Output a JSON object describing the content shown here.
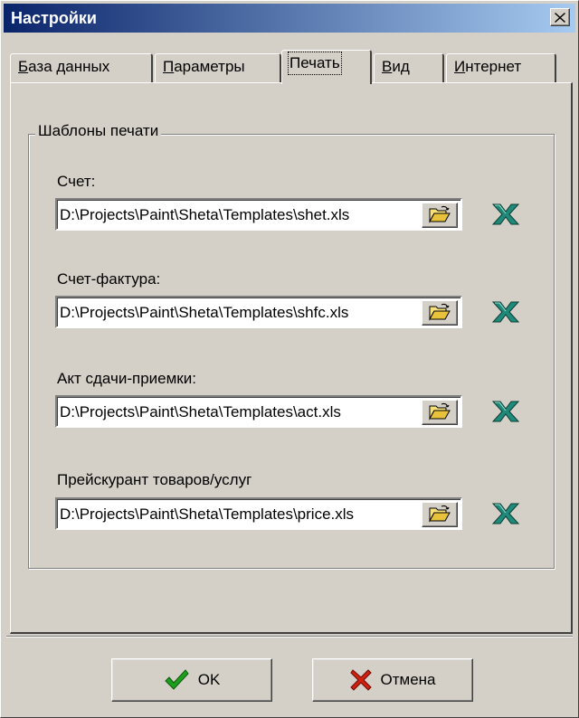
{
  "window": {
    "title": "Настройки"
  },
  "tabs": [
    {
      "key": "db",
      "label": "База данных",
      "accel": "Б",
      "rest": "аза данных"
    },
    {
      "key": "params",
      "label": "Параметры",
      "accel": "П",
      "rest": "араметры"
    },
    {
      "key": "print",
      "label": "Печать",
      "accel": "",
      "rest": "Печать",
      "active": true
    },
    {
      "key": "view",
      "label": "Вид",
      "accel": "В",
      "rest": "ид"
    },
    {
      "key": "internet",
      "label": "Интернет",
      "accel": "И",
      "rest": "нтернет"
    }
  ],
  "print_templates": {
    "group_title": "Шаблоны печати",
    "fields": [
      {
        "label": "Счет:",
        "value": "D:\\Projects\\Paint\\Sheta\\Templates\\shet.xls"
      },
      {
        "label": "Счет-фактура:",
        "value": "D:\\Projects\\Paint\\Sheta\\Templates\\shfc.xls"
      },
      {
        "label": "Акт сдачи-приемки:",
        "value": "D:\\Projects\\Paint\\Sheta\\Templates\\act.xls"
      },
      {
        "label": "Прейскурант товаров/услуг",
        "value": "D:\\Projects\\Paint\\Sheta\\Templates\\price.xls"
      }
    ]
  },
  "icons": {
    "browse": "folder-open-icon",
    "excel": "excel-icon",
    "ok": "checkmark-icon",
    "cancel": "cross-icon"
  },
  "colors": {
    "title_start": "#0a246a",
    "title_end": "#a6caf0",
    "face": "#d4d0c8",
    "ok_check": "#1e9e1e",
    "cancel_cross": "#d02010",
    "excel_green": "#1f8a7a"
  },
  "buttons": {
    "ok_label": "OK",
    "cancel_label": "Отмена"
  }
}
